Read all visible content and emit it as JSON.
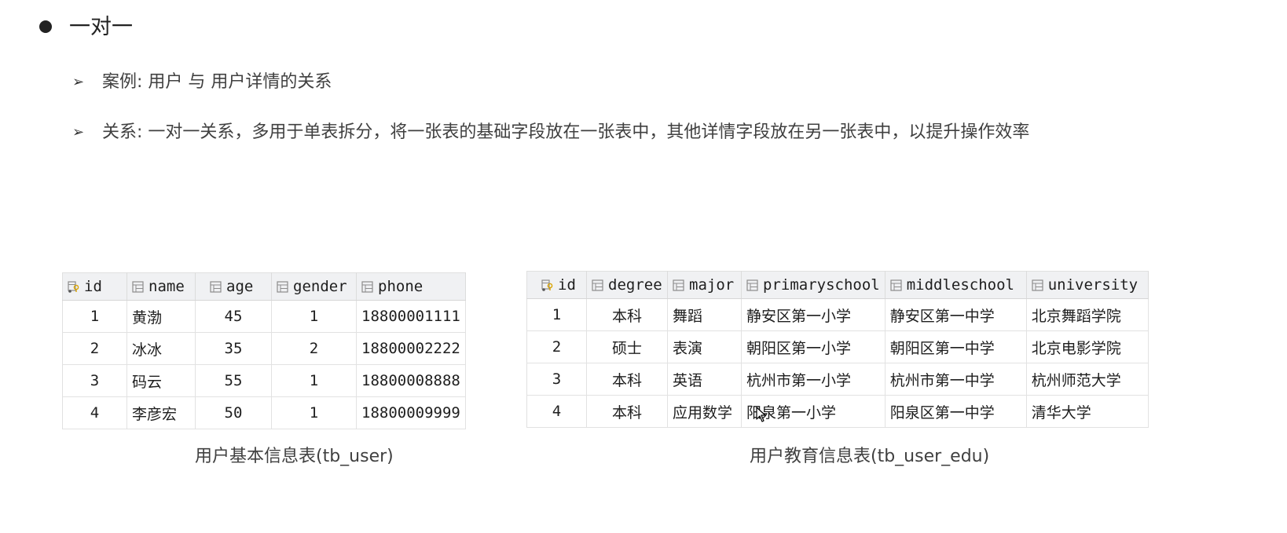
{
  "heading": "一对一",
  "lines": [
    "案例: 用户 与 用户详情的关系",
    "关系: 一对一关系，多用于单表拆分，将一张表的基础字段放在一张表中，其他详情字段放在另一张表中，以提升操作效率"
  ],
  "user_table": {
    "columns": [
      "id",
      "name",
      "age",
      "gender",
      "phone"
    ],
    "column_icons": [
      "primary-key-column-icon",
      "column-icon",
      "column-icon",
      "column-icon",
      "column-icon"
    ],
    "rows": [
      [
        "1",
        "黄渤",
        "45",
        "1",
        "18800001111"
      ],
      [
        "2",
        "冰冰",
        "35",
        "2",
        "18800002222"
      ],
      [
        "3",
        "码云",
        "55",
        "1",
        "18800008888"
      ],
      [
        "4",
        "李彦宏",
        "50",
        "1",
        "18800009999"
      ]
    ],
    "caption": "用户基本信息表(tb_user)"
  },
  "edu_table": {
    "columns": [
      "id",
      "degree",
      "major",
      "primaryschool",
      "middleschool",
      "university"
    ],
    "column_icons": [
      "primary-key-column-icon",
      "column-icon",
      "column-icon",
      "column-icon",
      "column-icon",
      "column-icon"
    ],
    "rows": [
      [
        "1",
        "本科",
        "舞蹈",
        "静安区第一小学",
        "静安区第一中学",
        "北京舞蹈学院"
      ],
      [
        "2",
        "硕士",
        "表演",
        "朝阳区第一小学",
        "朝阳区第一中学",
        "北京电影学院"
      ],
      [
        "3",
        "本科",
        "英语",
        "杭州市第一小学",
        "杭州市第一中学",
        "杭州师范大学"
      ],
      [
        "4",
        "本科",
        "应用数学",
        "阳泉第一小学",
        "阳泉区第一中学",
        "清华大学"
      ]
    ],
    "caption": "用户教育信息表(tb_user_edu)"
  }
}
